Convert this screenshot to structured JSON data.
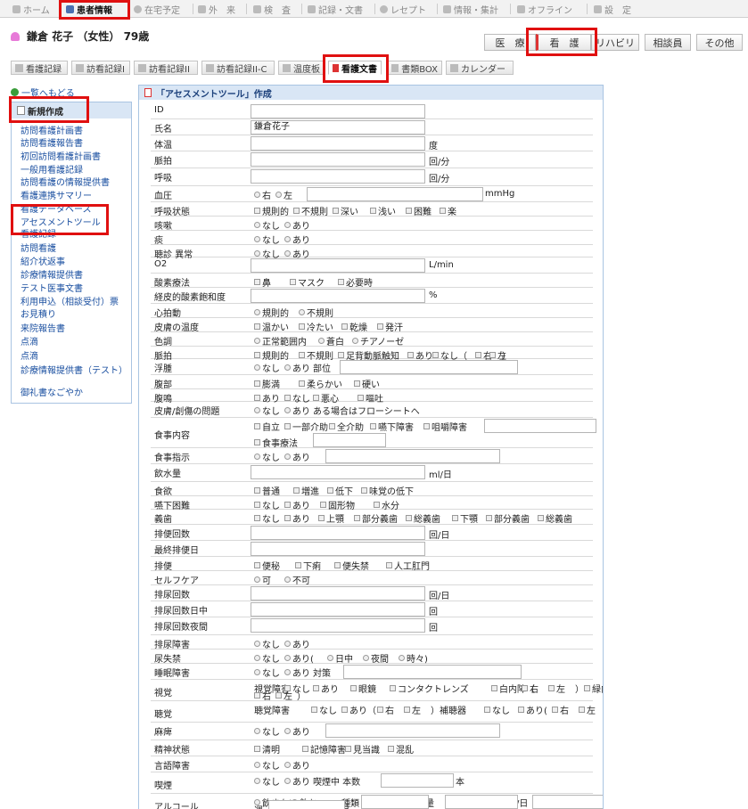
{
  "topnav": {
    "home": "ホーム",
    "patient": "患者情報",
    "schedule": "在宅予定",
    "outpatient": "外　来",
    "exam": "検　査",
    "records": "記録・文書",
    "receipt": "レセプト",
    "info": "情報・集計",
    "offline": "オフライン",
    "settings": "設　定"
  },
  "patient": {
    "name": "鎌倉 花子",
    "gender": "（女性）",
    "age": "79歳"
  },
  "role_tabs": [
    "医　療",
    "看　護",
    "リハビリ",
    "相談員",
    "その他"
  ],
  "doc_tabs": [
    "看護記録",
    "訪看記録I",
    "訪看記録II",
    "訪看記録II-C",
    "温度板",
    "看護文書",
    "書類BOX",
    "カレンダー"
  ],
  "back_link": "一覧へもどる",
  "sidebar": {
    "header": "新規作成",
    "items": [
      "訪問看護計画書",
      "訪問看護報告書",
      "初回訪問看護計画書",
      "一般用看護記録",
      "訪問看護の情報提供書",
      "看護連携サマリー",
      "看護データベース",
      "アセスメントツール",
      "看護記録",
      "訪問看護",
      "紹介状返事",
      "診療情報提供書",
      "テスト医事文書",
      "利用申込（相談受付）票",
      "お見積り",
      "来院報告書",
      "点滴",
      "点滴",
      "診療情報提供書（テスト）",
      "御礼書なごやか"
    ]
  },
  "panel": {
    "title": "「アセスメントツール」作成"
  },
  "form": [
    {
      "label": "ID",
      "input": ""
    },
    {
      "label": "氏名",
      "input": "鎌倉花子"
    },
    {
      "label": "体温",
      "input": "",
      "unit": "度"
    },
    {
      "label": "脈拍",
      "input": "",
      "unit": "回/分"
    },
    {
      "label": "呼吸",
      "input": "",
      "unit": "回/分"
    },
    {
      "label": "血圧",
      "opts": [
        "右",
        "左"
      ],
      "unit": "mmHg"
    },
    {
      "label": "呼吸状態",
      "opts": [
        "規則的",
        "不規則",
        "深い",
        "浅い",
        "困難",
        "楽"
      ]
    },
    {
      "label": "咳嗽",
      "opts": [
        "なし",
        "あり"
      ]
    },
    {
      "label": "痰",
      "opts": [
        "なし",
        "あり"
      ]
    },
    {
      "label": "聴診 異常",
      "opts": [
        "なし",
        "あり"
      ]
    },
    {
      "label": "O2",
      "input": "",
      "unit": "L/min"
    },
    {
      "label": "酸素療法",
      "opts": [
        "鼻",
        "マスク",
        "必要時"
      ]
    },
    {
      "label": "経皮的酸素飽和度",
      "input": "",
      "unit": "%"
    },
    {
      "label": "心拍動",
      "opts": [
        "規則的",
        "不規則"
      ]
    },
    {
      "label": "皮膚の温度",
      "opts": [
        "温かい",
        "冷たい",
        "乾燥",
        "発汗"
      ]
    },
    {
      "label": "色調",
      "opts": [
        "正常範囲内",
        "蒼白",
        "チアノーゼ"
      ]
    },
    {
      "label": "脈拍",
      "opts": [
        "規則的",
        "不規則",
        "足背動脈触知",
        "あり",
        "なし（",
        "右",
        "左",
        "）"
      ]
    },
    {
      "label": "浮腫",
      "opts": [
        "なし",
        "あり",
        "部位"
      ]
    },
    {
      "label": "腹部",
      "opts": [
        "膨満",
        "柔らかい",
        "硬い"
      ]
    },
    {
      "label": "腹鳴",
      "opts": [
        "あり",
        "なし",
        "悪心",
        "嘔吐"
      ]
    },
    {
      "label": "皮膚/創傷の問題",
      "opts": [
        "なし",
        "あり",
        "ある場合はフローシートへ"
      ]
    },
    {
      "label": "食事内容",
      "opts": [
        "自立",
        "一部介助",
        "全介助",
        "嚥下障害",
        "咀嚼障害",
        "Fr",
        "食事療法"
      ]
    },
    {
      "label": "食事指示",
      "opts": [
        "なし",
        "あり"
      ]
    },
    {
      "label": "飲水量",
      "input": "",
      "unit": "ml/日"
    },
    {
      "label": "食欲",
      "opts": [
        "普通",
        "増進",
        "低下",
        "味覚の低下"
      ]
    },
    {
      "label": "嚥下困難",
      "opts": [
        "なし",
        "あり",
        "固形物",
        "水分"
      ]
    },
    {
      "label": "義歯",
      "opts": [
        "なし",
        "あり",
        "上顎",
        "部分義歯",
        "総義歯",
        "下顎",
        "部分義歯",
        "総義歯"
      ]
    },
    {
      "label": "排便回数",
      "input": "",
      "unit": "回/日"
    },
    {
      "label": "最終排便日",
      "input": ""
    },
    {
      "label": "排便",
      "opts": [
        "便秘",
        "下痢",
        "便失禁",
        "人工肛門"
      ]
    },
    {
      "label": "セルフケア",
      "opts": [
        "可",
        "不可"
      ]
    },
    {
      "label": "排尿回数",
      "input": "",
      "unit": "回/日"
    },
    {
      "label": "排尿回数日中",
      "input": "",
      "unit": "回"
    },
    {
      "label": "排尿回数夜間",
      "input": "",
      "unit": "回"
    },
    {
      "label": "排尿障害",
      "opts": [
        "なし",
        "あり"
      ]
    },
    {
      "label": "尿失禁",
      "opts": [
        "なし",
        "あり(",
        "日中",
        "夜間",
        "時々)"
      ]
    },
    {
      "label": "睡眠障害",
      "opts": [
        "なし",
        "あり",
        "対策"
      ]
    },
    {
      "label": "視覚",
      "opts": [
        "視覚障害",
        "なし",
        "あり",
        "眼鏡",
        "コンタクトレンズ",
        "白内障（",
        "右",
        "左",
        "）",
        "緑内障（",
        "右",
        "左",
        "）"
      ]
    },
    {
      "label": "聴覚",
      "opts": [
        "聴覚障害",
        "なし",
        "あり（",
        "右",
        "左",
        "）補聴器",
        "なし",
        "あり(",
        "右",
        "左",
        "）"
      ]
    },
    {
      "label": "麻痺",
      "opts": [
        "なし",
        "あり"
      ]
    },
    {
      "label": "精神状態",
      "opts": [
        "清明",
        "記憶障害",
        "見当識",
        "混乱"
      ]
    },
    {
      "label": "言語障害",
      "opts": [
        "なし",
        "あり"
      ]
    },
    {
      "label": "喫煙",
      "opts": [
        "なし",
        "あり",
        "喫煙中 本数",
        "本"
      ]
    },
    {
      "label": "アルコール",
      "opts": [
        "飲まない",
        "飲む",
        "種類",
        "量",
        "/日",
        "/",
        "週",
        "/月"
      ]
    }
  ]
}
